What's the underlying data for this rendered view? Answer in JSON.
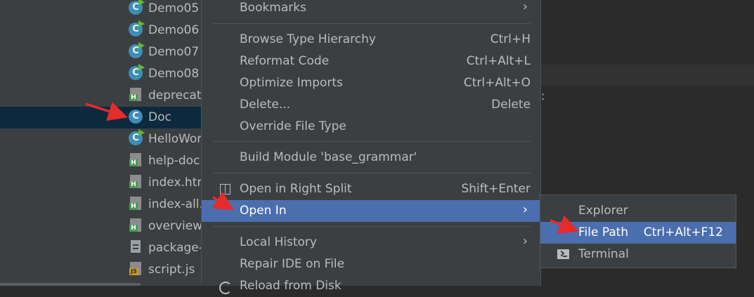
{
  "tree": {
    "items": [
      {
        "label": "Demo05",
        "icon": "java-class-run-icon"
      },
      {
        "label": "Demo06",
        "icon": "java-class-run-icon"
      },
      {
        "label": "Demo07",
        "icon": "java-class-run-icon"
      },
      {
        "label": "Demo08",
        "icon": "java-class-run-icon"
      },
      {
        "label": "deprecated-list.html",
        "icon": "html-file-icon"
      },
      {
        "label": "Doc",
        "icon": "java-class-icon"
      },
      {
        "label": "HelloWorld",
        "icon": "java-class-run-icon"
      },
      {
        "label": "help-doc.html",
        "icon": "html-file-icon"
      },
      {
        "label": "index.html",
        "icon": "html-file-icon"
      },
      {
        "label": "index-all.html",
        "icon": "html-file-icon"
      },
      {
        "label": "overview-tree.html",
        "icon": "html-file-icon"
      },
      {
        "label": "package-list",
        "icon": "text-file-icon"
      },
      {
        "label": "script.js",
        "icon": "js-file-icon"
      }
    ],
    "selected": "Doc"
  },
  "context_menu": {
    "bookmarks": "Bookmarks",
    "browse_type_hierarchy": {
      "label": "Browse Type Hierarchy",
      "shortcut": "Ctrl+H"
    },
    "reformat_code": {
      "label": "Reformat Code",
      "shortcut": "Ctrl+Alt+L"
    },
    "optimize_imports": {
      "label": "Optimize Imports",
      "shortcut": "Ctrl+Alt+O"
    },
    "delete": {
      "label": "Delete...",
      "shortcut": "Delete"
    },
    "override_file_type": "Override File Type",
    "build_module": "Build Module 'base_grammar'",
    "open_in_right_split": {
      "label": "Open in Right Split",
      "shortcut": "Shift+Enter"
    },
    "open_in": "Open In",
    "local_history": "Local History",
    "repair_ide": "Repair IDE on File",
    "reload_from_disk": "Reload from Disk"
  },
  "submenu": {
    "explorer": "Explorer",
    "file_path": {
      "label": "File Path",
      "shortcut": "Ctrl+Alt+F12"
    },
    "terminal": "Terminal"
  },
  "editor": {
    "glyph": ":"
  },
  "colors": {
    "menu_bg": "#3c3f41",
    "highlight": "#4b6eaf",
    "selection": "#0d293e",
    "annotation_arrow": "#e52b2b"
  }
}
